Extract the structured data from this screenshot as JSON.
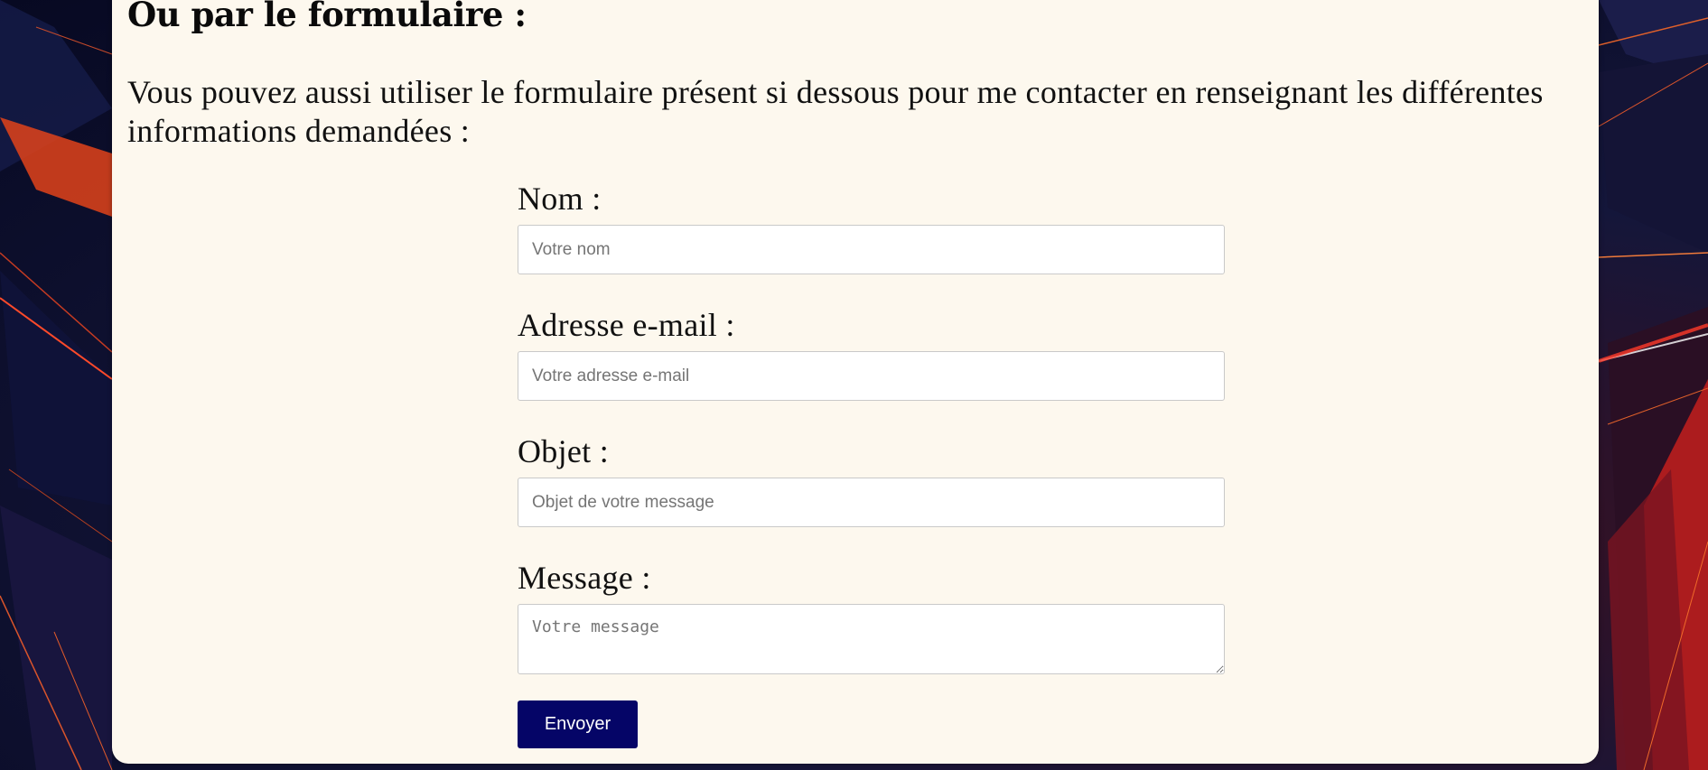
{
  "section": {
    "heading": "Ou par le formulaire :",
    "intro": "Vous pouvez aussi utiliser le formulaire présent si dessous pour me contacter en renseignant les différentes informations demandées :"
  },
  "form": {
    "name_label": "Nom :",
    "name_placeholder": "Votre nom",
    "email_label": "Adresse e-mail :",
    "email_placeholder": "Votre adresse e-mail",
    "subject_label": "Objet :",
    "subject_placeholder": "Objet de votre message",
    "message_label": "Message :",
    "message_placeholder": "Votre message",
    "submit_label": "Envoyer"
  },
  "colors": {
    "card_background": "#fdf8ee",
    "button_background": "#050567",
    "page_background": "#0d1030",
    "accent_lines": "#e8401e"
  }
}
